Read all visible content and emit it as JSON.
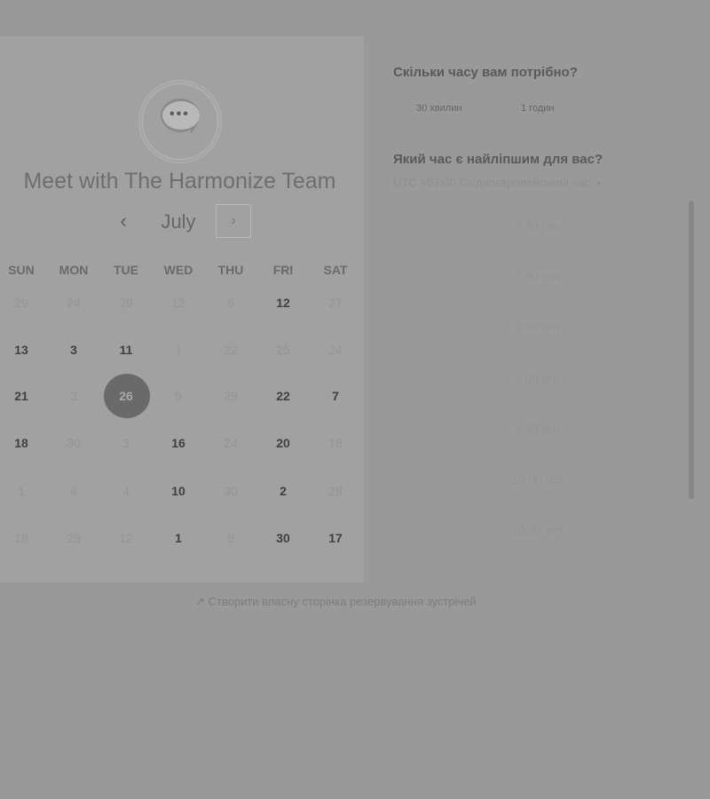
{
  "scheduler": {
    "title": "Meet with The Harmonize Team",
    "month": "July",
    "prev_glyph": "‹",
    "next_glyph": "›",
    "logo_dots": "•••",
    "weekdays": [
      "SUN",
      "MON",
      "TUE",
      "WED",
      "THU",
      "FRI",
      "SAT"
    ],
    "weeks": [
      [
        "29",
        "24",
        "29",
        "12",
        "6",
        "12",
        "27"
      ],
      [
        "13",
        "3",
        "11",
        "1",
        "22",
        "25",
        "24"
      ],
      [
        "21",
        "3",
        "26",
        "9",
        "29",
        "22",
        "7"
      ],
      [
        "18",
        "30",
        "3",
        "16",
        "24",
        "20",
        "18"
      ],
      [
        "1",
        "4",
        "4",
        "10",
        "30",
        "2",
        "28"
      ],
      [
        "18",
        "29",
        "12",
        "1",
        "9",
        "30",
        "17"
      ]
    ],
    "selected_day": "26"
  },
  "sidebar": {
    "duration_title": "Скільки часу вам потрібно?",
    "durations": [
      "30 хвилин",
      "1 годин"
    ],
    "time_title": "Який час є найліпшим для вас?",
    "timezone": "UTC +03:00 Східноєвропейський час",
    "timezone_arrow": "▾",
    "slots": [
      "7:30 pm",
      "8:00 pm",
      "8:30 pm",
      "9:00 pm",
      "9:30 pm",
      "10:00 pm",
      "10:30 pm"
    ]
  },
  "footer": {
    "icon_glyph": "↗",
    "text": "Створити власну сторінка резервування зустрічей"
  },
  "colors": {
    "overlay_bg": "#999999",
    "card_bg": "#a1a1a1",
    "selected_day_bg": "#6a6a6a"
  }
}
